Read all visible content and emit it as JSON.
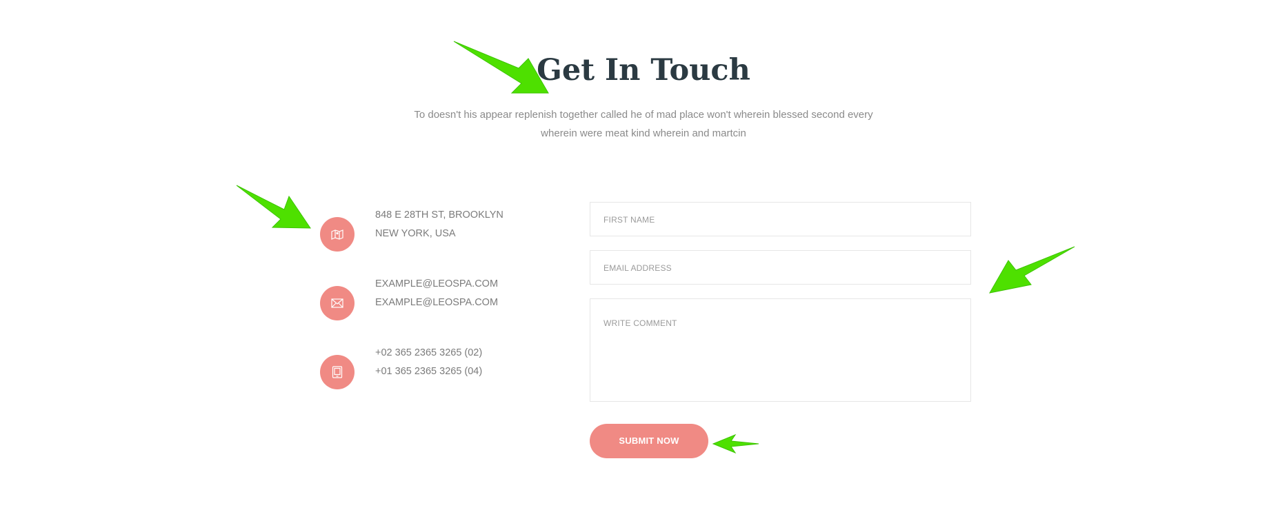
{
  "section": {
    "title": "Get In Touch",
    "subtitle_line1": "To doesn't his appear replenish together called he of mad place won't wherein blessed second every",
    "subtitle_line2": "wherein were meat kind wherein and martcin"
  },
  "contact": {
    "address": {
      "icon": "map-icon",
      "line1": "848 E 28TH ST, BROOKLYN",
      "line2": "NEW YORK, USA"
    },
    "email": {
      "icon": "envelope-icon",
      "line1": "EXAMPLE@LEOSPA.COM",
      "line2": "EXAMPLE@LEOSPA.COM"
    },
    "phone": {
      "icon": "tablet-icon",
      "line1": "+02 365 2365 3265 (02)",
      "line2": "+01 365 2365 3265 (04)"
    }
  },
  "form": {
    "first_name_placeholder": "FIRST NAME",
    "email_placeholder": "EMAIL ADDRESS",
    "comment_placeholder": "WRITE COMMENT",
    "submit_label": "SUBMIT NOW"
  },
  "colors": {
    "accent": "#f08a84",
    "heading": "#2b3a42",
    "text": "#7b7b7b",
    "annotation_arrow": "#4ee000"
  }
}
